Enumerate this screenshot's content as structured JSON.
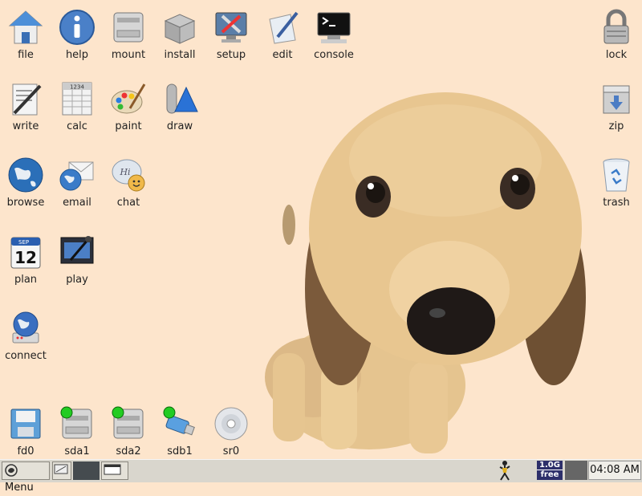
{
  "desktop": {
    "icons": [
      {
        "label": "file",
        "icon": "home-folder-icon"
      },
      {
        "label": "help",
        "icon": "info-icon"
      },
      {
        "label": "mount",
        "icon": "hard-drive-icon"
      },
      {
        "label": "install",
        "icon": "package-box-icon"
      },
      {
        "label": "setup",
        "icon": "tools-monitor-icon"
      },
      {
        "label": "edit",
        "icon": "pen-paper-icon"
      },
      {
        "label": "console",
        "icon": "terminal-icon"
      },
      {
        "label": "lock",
        "icon": "padlock-icon"
      },
      {
        "label": "write",
        "icon": "writer-document-icon"
      },
      {
        "label": "calc",
        "icon": "spreadsheet-icon"
      },
      {
        "label": "paint",
        "icon": "palette-icon"
      },
      {
        "label": "draw",
        "icon": "shapes-icon"
      },
      {
        "label": "zip",
        "icon": "archive-box-icon"
      },
      {
        "label": "browse",
        "icon": "globe-icon"
      },
      {
        "label": "email",
        "icon": "email-icon"
      },
      {
        "label": "chat",
        "icon": "chat-bubble-icon"
      },
      {
        "label": "trash",
        "icon": "trash-bin-icon"
      },
      {
        "label": "plan",
        "icon": "calendar-icon"
      },
      {
        "label": "play",
        "icon": "media-player-icon"
      },
      {
        "label": "connect",
        "icon": "network-globe-icon"
      },
      {
        "label": "fd0",
        "icon": "floppy-disk-icon"
      },
      {
        "label": "sda1",
        "icon": "drive-mounted-icon"
      },
      {
        "label": "sda2",
        "icon": "drive-mounted-icon"
      },
      {
        "label": "sdb1",
        "icon": "usb-drive-mounted-icon"
      },
      {
        "label": "sr0",
        "icon": "optical-disc-icon"
      }
    ],
    "calendar_day": "12",
    "calendar_month": "SEP",
    "calc_header": "1234",
    "chat_text": "Hi"
  },
  "taskbar": {
    "menu_label": "Menu",
    "memory_free_top": "1.0G",
    "memory_free_bottom": "free",
    "clock": "04:08 AM"
  },
  "colors": {
    "desktop_bg": "#fde5cc",
    "taskbar_bg": "#d9d6cd",
    "mounted_indicator": "#22cc22"
  }
}
